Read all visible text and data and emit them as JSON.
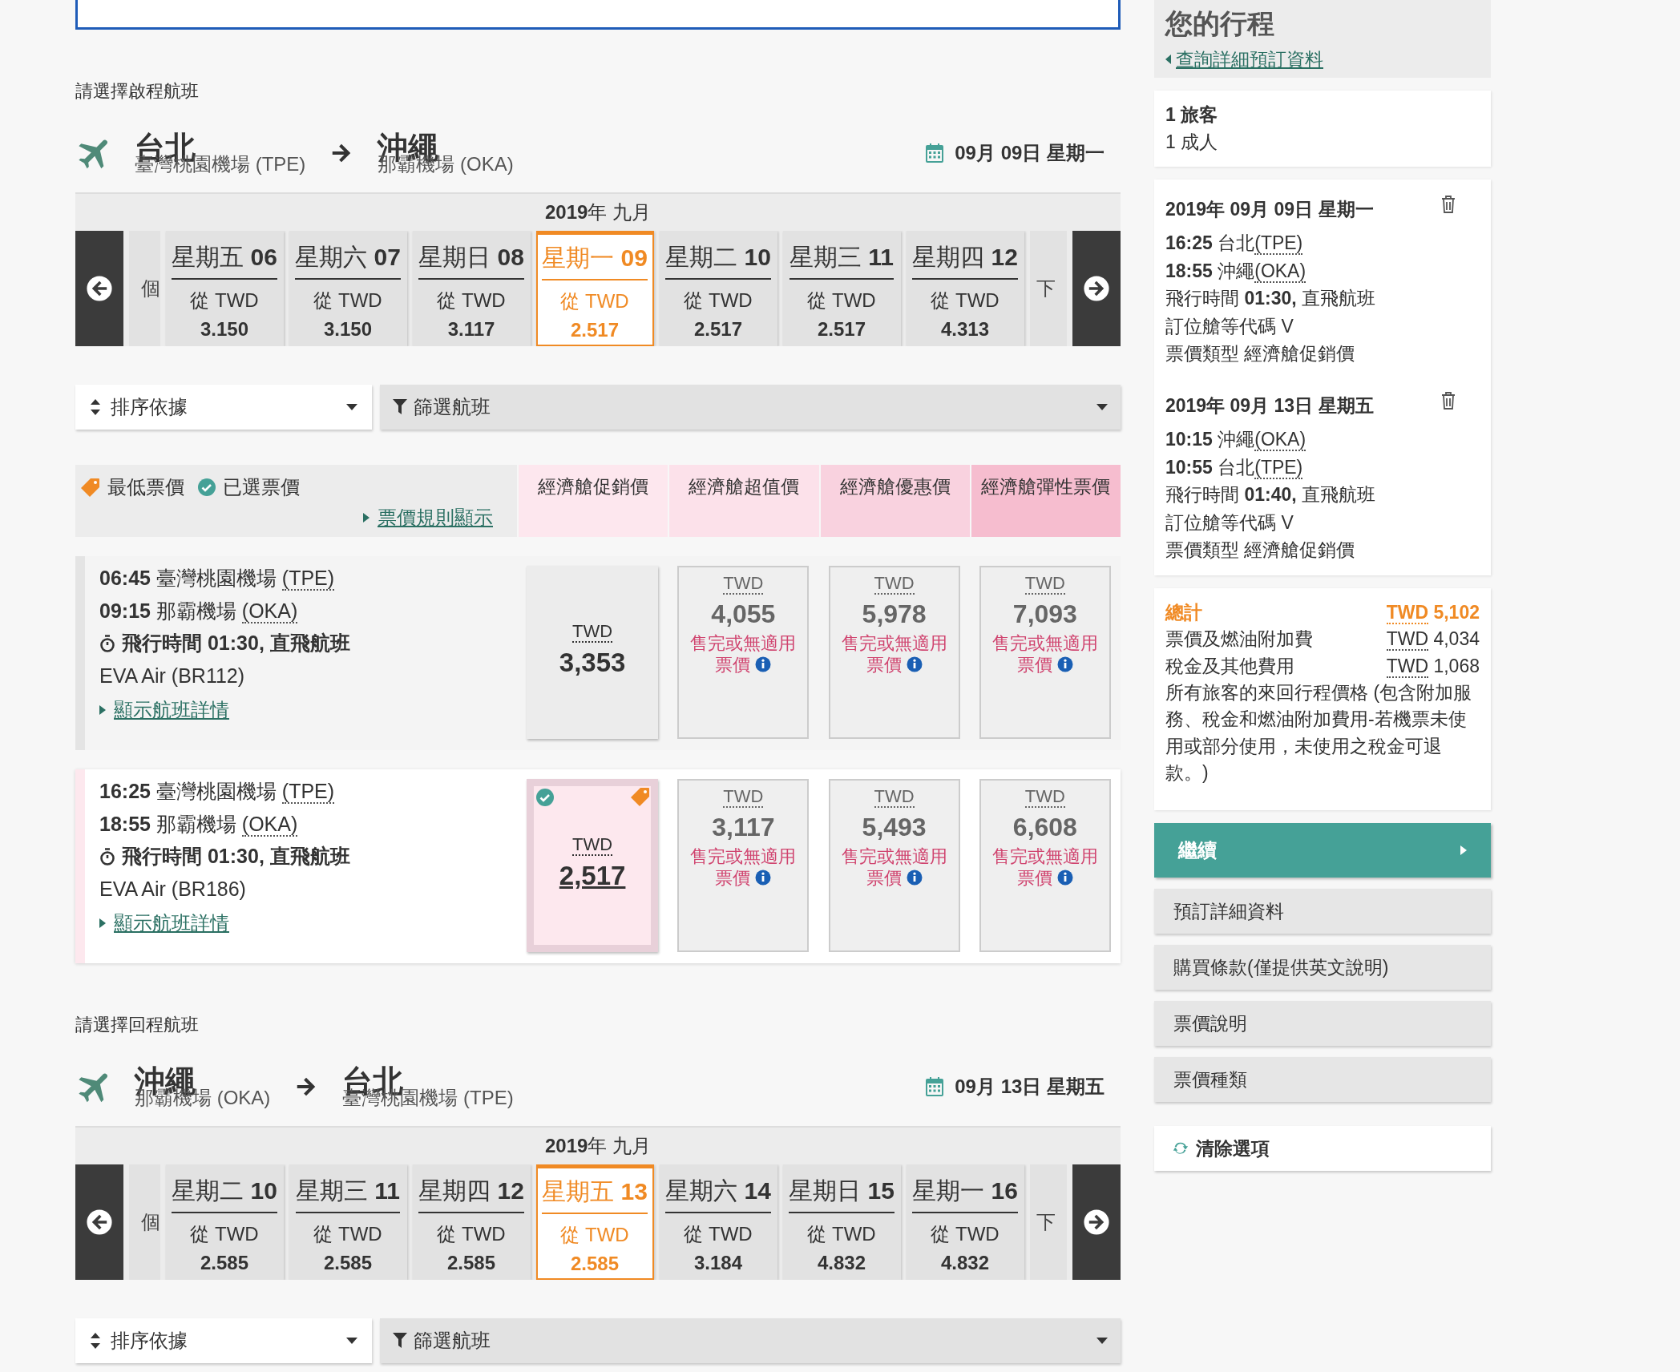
{
  "outbound": {
    "heading": "請選擇啟程航班",
    "from": {
      "city": "台北",
      "airport": "臺灣桃園機場 (TPE)"
    },
    "to": {
      "city": "沖繩",
      "airport": "那霸機場 (OKA)"
    },
    "date": "09月 09日 星期一",
    "month": "**2019**年 九月",
    "prev_fragment": "個",
    "next_fragment": "下",
    "days": [
      {
        "label": "星期五 **06**",
        "from": "從 TWD",
        "price": "3.150",
        "selected": false
      },
      {
        "label": "星期六 **07**",
        "from": "從 TWD",
        "price": "3.150",
        "selected": false
      },
      {
        "label": "星期日 **08**",
        "from": "從 TWD",
        "price": "3.117",
        "selected": false
      },
      {
        "label": "星期一 **09**",
        "from": "從 TWD",
        "price": "2.517",
        "selected": true
      },
      {
        "label": "星期二 **10**",
        "from": "從 TWD",
        "price": "2.517",
        "selected": false
      },
      {
        "label": "星期三 **11**",
        "from": "從 TWD",
        "price": "2.517",
        "selected": false
      },
      {
        "label": "星期四 **12**",
        "from": "從 TWD",
        "price": "4.313",
        "selected": false
      }
    ],
    "sort": "排序依據",
    "filter": "篩選航班",
    "legend": {
      "lowest": "最低票價",
      "chosen": "已選票價",
      "rules_link": "票價規則顯示"
    },
    "fare_columns": [
      {
        "label": "經濟艙促銷價",
        "color": "#fde7ee"
      },
      {
        "label": "經濟艙超值價",
        "color": "#fce1ea"
      },
      {
        "label": "經濟艙優惠價",
        "color": "#f9d2df"
      },
      {
        "label": "經濟艙彈性票價",
        "color": "#f6bdcf"
      }
    ],
    "flights": [
      {
        "selected": false,
        "depart": {
          "time": "06:45",
          "airport": "臺灣桃園機場",
          "code": "(TPE)"
        },
        "arrive": {
          "time": "09:15",
          "airport": "那霸機場",
          "code": "(OKA)"
        },
        "duration": "飛行時間 01:30, 直飛航班",
        "airline": "EVA Air (BR112)",
        "details_link": "顯示航班詳情",
        "fares": [
          {
            "kind": "available",
            "currency": "TWD",
            "price": "3,353",
            "selected": false,
            "lowest": false
          },
          {
            "kind": "soldout",
            "currency": "TWD",
            "price": "4,055",
            "note": "售完或無適用票價"
          },
          {
            "kind": "soldout",
            "currency": "TWD",
            "price": "5,978",
            "note": "售完或無適用票價"
          },
          {
            "kind": "soldout",
            "currency": "TWD",
            "price": "7,093",
            "note": "售完或無適用票價"
          }
        ]
      },
      {
        "selected": true,
        "depart": {
          "time": "16:25",
          "airport": "臺灣桃園機場",
          "code": "(TPE)"
        },
        "arrive": {
          "time": "18:55",
          "airport": "那霸機場",
          "code": "(OKA)"
        },
        "duration": "飛行時間 01:30, 直飛航班",
        "airline": "EVA Air (BR186)",
        "details_link": "顯示航班詳情",
        "fares": [
          {
            "kind": "available",
            "currency": "TWD",
            "price": "2,517",
            "selected": true,
            "lowest": true
          },
          {
            "kind": "soldout",
            "currency": "TWD",
            "price": "3,117",
            "note": "售完或無適用票價"
          },
          {
            "kind": "soldout",
            "currency": "TWD",
            "price": "5,493",
            "note": "售完或無適用票價"
          },
          {
            "kind": "soldout",
            "currency": "TWD",
            "price": "6,608",
            "note": "售完或無適用票價"
          }
        ]
      }
    ]
  },
  "return": {
    "heading": "請選擇回程航班",
    "from": {
      "city": "沖繩",
      "airport": "那霸機場 (OKA)"
    },
    "to": {
      "city": "台北",
      "airport": "臺灣桃園機場 (TPE)"
    },
    "date": "09月 13日 星期五",
    "month": "**2019**年 九月",
    "prev_fragment": "個",
    "next_fragment": "下",
    "days": [
      {
        "label": "星期二 **10**",
        "from": "從 TWD",
        "price": "2.585",
        "selected": false
      },
      {
        "label": "星期三 **11**",
        "from": "從 TWD",
        "price": "2.585",
        "selected": false
      },
      {
        "label": "星期四 **12**",
        "from": "從 TWD",
        "price": "2.585",
        "selected": false
      },
      {
        "label": "星期五 **13**",
        "from": "從 TWD",
        "price": "2.585",
        "selected": true
      },
      {
        "label": "星期六 **14**",
        "from": "從 TWD",
        "price": "3.184",
        "selected": false
      },
      {
        "label": "星期日 **15**",
        "from": "從 TWD",
        "price": "4.832",
        "selected": false
      },
      {
        "label": "星期一 **16**",
        "from": "從 TWD",
        "price": "4.832",
        "selected": false
      }
    ],
    "sort": "排序依據",
    "filter": "篩選航班"
  },
  "sidebar": {
    "title": "您的行程",
    "back_link": "查詢詳細預訂資料",
    "travelers": {
      "count": "1 旅客",
      "detail": "1 成人"
    },
    "segments": [
      {
        "date": "2019年 09月 09日 星期一",
        "depart": {
          "time": "16:25",
          "city": "台北",
          "code": "(TPE)"
        },
        "arrive": {
          "time": "18:55",
          "city": "沖繩",
          "code": "(OKA)"
        },
        "duration": "飛行時間 **01:30,** 直飛航班",
        "booking_class": "訂位艙等代碼 V",
        "fare_type": "票價類型 經濟艙促銷價"
      },
      {
        "date": "2019年 09月 13日 星期五",
        "depart": {
          "time": "10:15",
          "city": "沖繩",
          "code": "(OKA)"
        },
        "arrive": {
          "time": "10:55",
          "city": "台北",
          "code": "(TPE)"
        },
        "duration": "飛行時間 **01:40,** 直飛航班",
        "booking_class": "訂位艙等代碼 V",
        "fare_type": "票價類型 經濟艙促銷價"
      }
    ],
    "total": {
      "label": "總計",
      "currency": "TWD",
      "amount": "5,102"
    },
    "breakdown": [
      {
        "label": "票價及燃油附加費",
        "currency": "TWD",
        "amount": "4,034"
      },
      {
        "label": "稅金及其他費用",
        "currency": "TWD",
        "amount": "1,068"
      }
    ],
    "note": "所有旅客的來回行程價格 (包含附加服務、稅金和燃油附加費用-若機票未使用或部分使用，未使用之稅金可退款。)",
    "continue": "繼續",
    "links": [
      "預訂詳細資料",
      "購買條款(僅提供英文說明)",
      "票價說明",
      "票價種類"
    ],
    "clear": "清除選項"
  }
}
